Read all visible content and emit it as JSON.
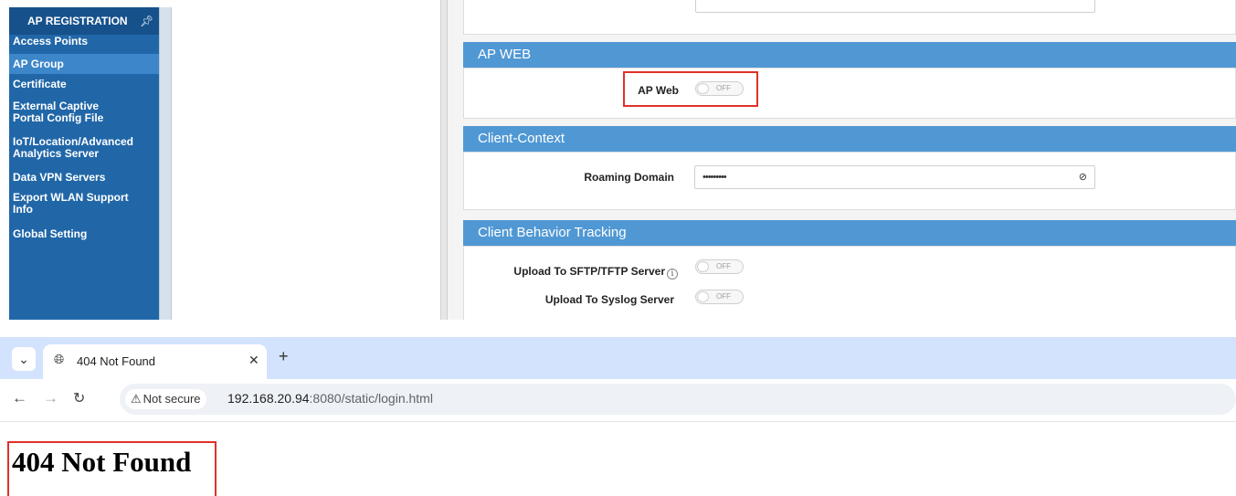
{
  "sidebar": {
    "header": "AP REGISTRATION",
    "pin_icon": "pin-icon",
    "items": [
      {
        "label": "Access Points"
      },
      {
        "label": "AP Group",
        "active": true
      },
      {
        "label": "Certificate"
      },
      {
        "label": "External Captive Portal Config File"
      },
      {
        "label": "IoT/Location/Advanced Analytics Server"
      },
      {
        "label": "Data VPN Servers"
      },
      {
        "label": "Export WLAN Support Info"
      },
      {
        "label": "Global Setting"
      }
    ]
  },
  "main": {
    "ap_web": {
      "header": "AP WEB",
      "label": "AP Web",
      "toggle": "OFF"
    },
    "client_context": {
      "header": "Client-Context",
      "roaming_label": "Roaming Domain",
      "roaming_value": "•••••••••",
      "eye_icon": "eye-slash-icon"
    },
    "client_behavior": {
      "header": "Client Behavior Tracking",
      "sftp_label": "Upload To SFTP/TFTP Server",
      "sftp_info": "i",
      "sftp_toggle": "OFF",
      "syslog_label": "Upload To Syslog Server",
      "syslog_toggle": "OFF"
    }
  },
  "browser": {
    "tab_title": "404 Not Found",
    "security_label": "Not secure",
    "url_host": "192.168.20.94",
    "url_rest": ":8080/static/login.html",
    "page_heading": "404 Not Found"
  },
  "colors": {
    "sidebar_bg": "#2167a8",
    "section_header": "#5098d4",
    "highlight": "#e0312a",
    "tabstrip": "#d3e3fd"
  }
}
